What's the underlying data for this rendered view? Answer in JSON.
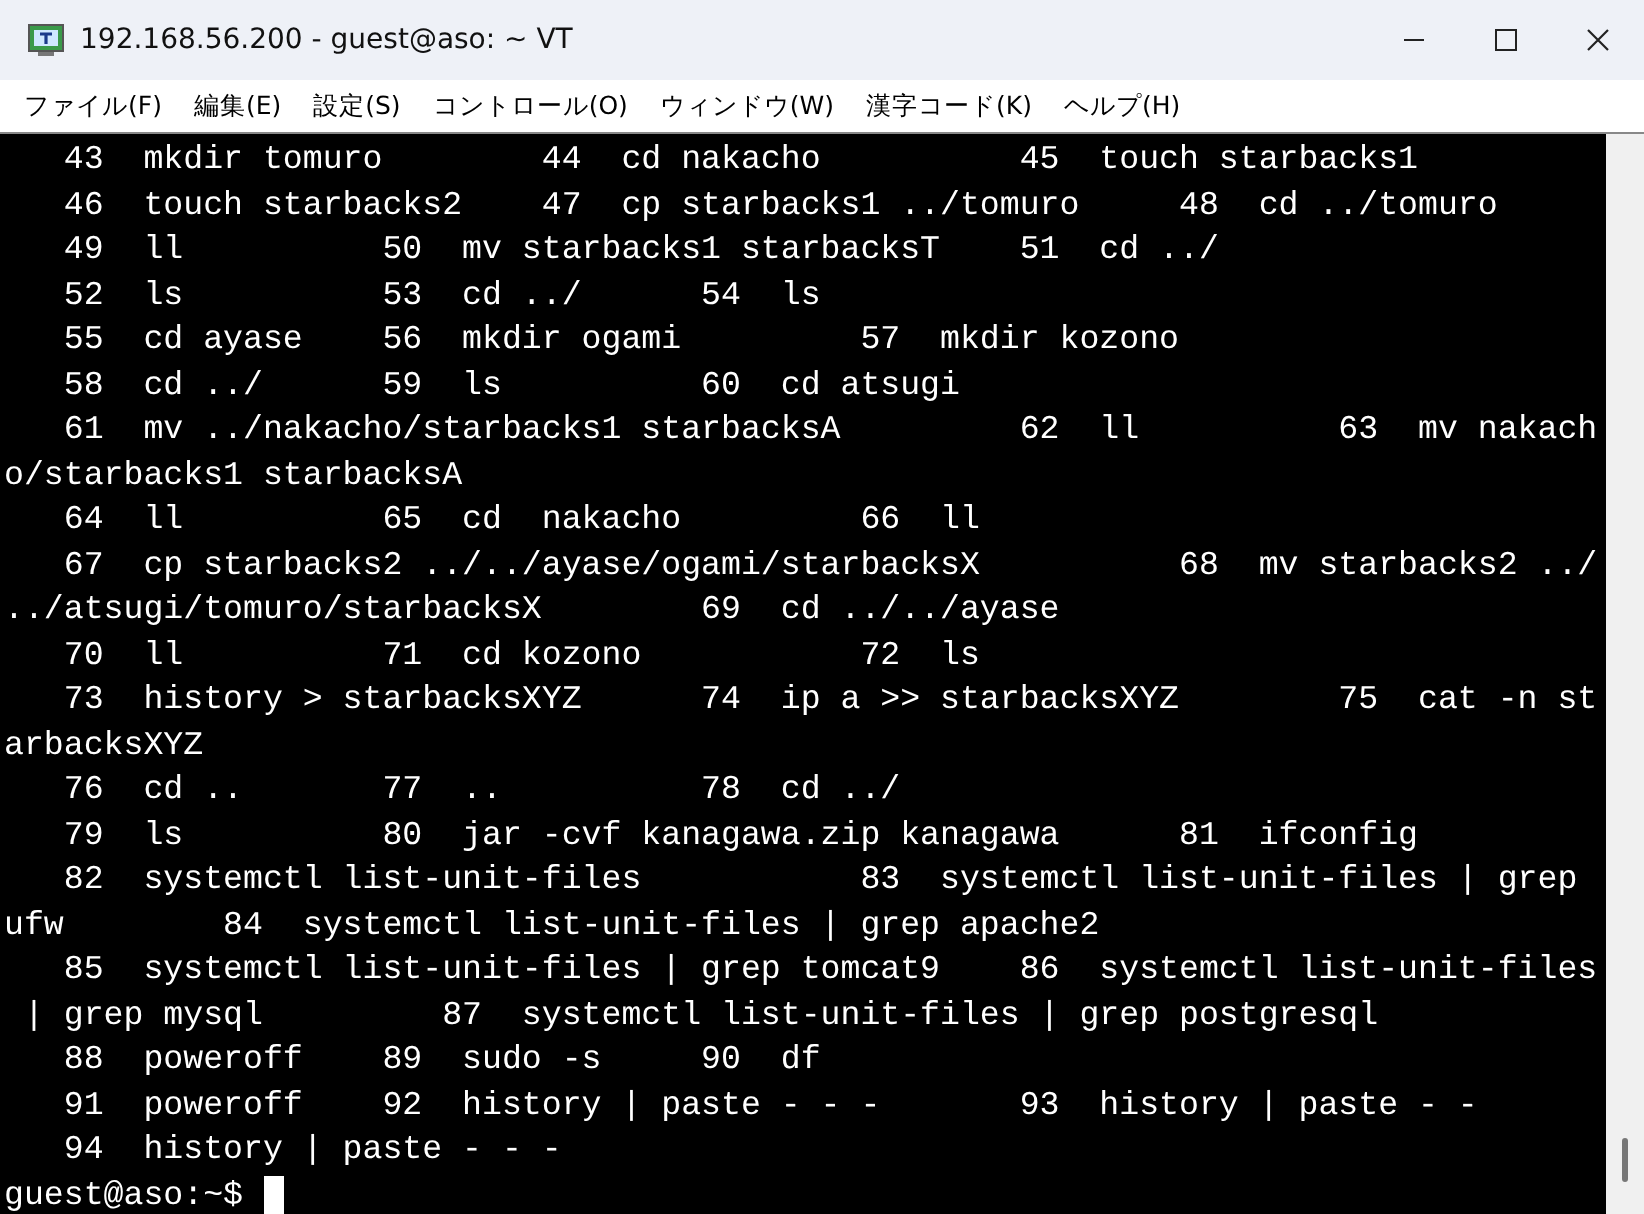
{
  "window": {
    "title": "192.168.56.200 - guest@aso: ~ VT"
  },
  "menu": [
    "ファイル(F)",
    "編集(E)",
    "設定(S)",
    "コントロール(O)",
    "ウィンドウ(W)",
    "漢字コード(K)",
    "ヘルプ(H)"
  ],
  "terminal": {
    "lines": [
      "   43  mkdir tomuro        44  cd nakacho          45  touch starbacks1",
      "   46  touch starbacks2    47  cp starbacks1 ../tomuro     48  cd ../tomuro",
      "   49  ll          50  mv starbacks1 starbacksT    51  cd ../",
      "   52  ls          53  cd ../      54  ls",
      "   55  cd ayase    56  mkdir ogami         57  mkdir kozono",
      "   58  cd ../      59  ls          60  cd atsugi",
      "   61  mv ../nakacho/starbacks1 starbacksA         62  ll          63  mv nakach",
      "o/starbacks1 starbacksA",
      "   64  ll          65  cd  nakacho         66  ll",
      "   67  cp starbacks2 ../../ayase/ogami/starbacksX          68  mv starbacks2 ../",
      "../atsugi/tomuro/starbacksX        69  cd ../../ayase",
      "   70  ll          71  cd kozono           72  ls",
      "   73  history > starbacksXYZ      74  ip a >> starbacksXYZ        75  cat -n st",
      "arbacksXYZ",
      "   76  cd ..       77  ..          78  cd ../",
      "   79  ls          80  jar -cvf kanagawa.zip kanagawa      81  ifconfig",
      "   82  systemctl list-unit-files           83  systemctl list-unit-files | grep",
      "ufw        84  systemctl list-unit-files | grep apache2",
      "   85  systemctl list-unit-files | grep tomcat9    86  systemctl list-unit-files",
      " | grep mysql         87  systemctl list-unit-files | grep postgresql",
      "   88  poweroff    89  sudo -s     90  df",
      "   91  poweroff    92  history | paste - - -       93  history | paste - -",
      "   94  history | paste - - -"
    ],
    "prompt": "guest@aso:~$"
  }
}
